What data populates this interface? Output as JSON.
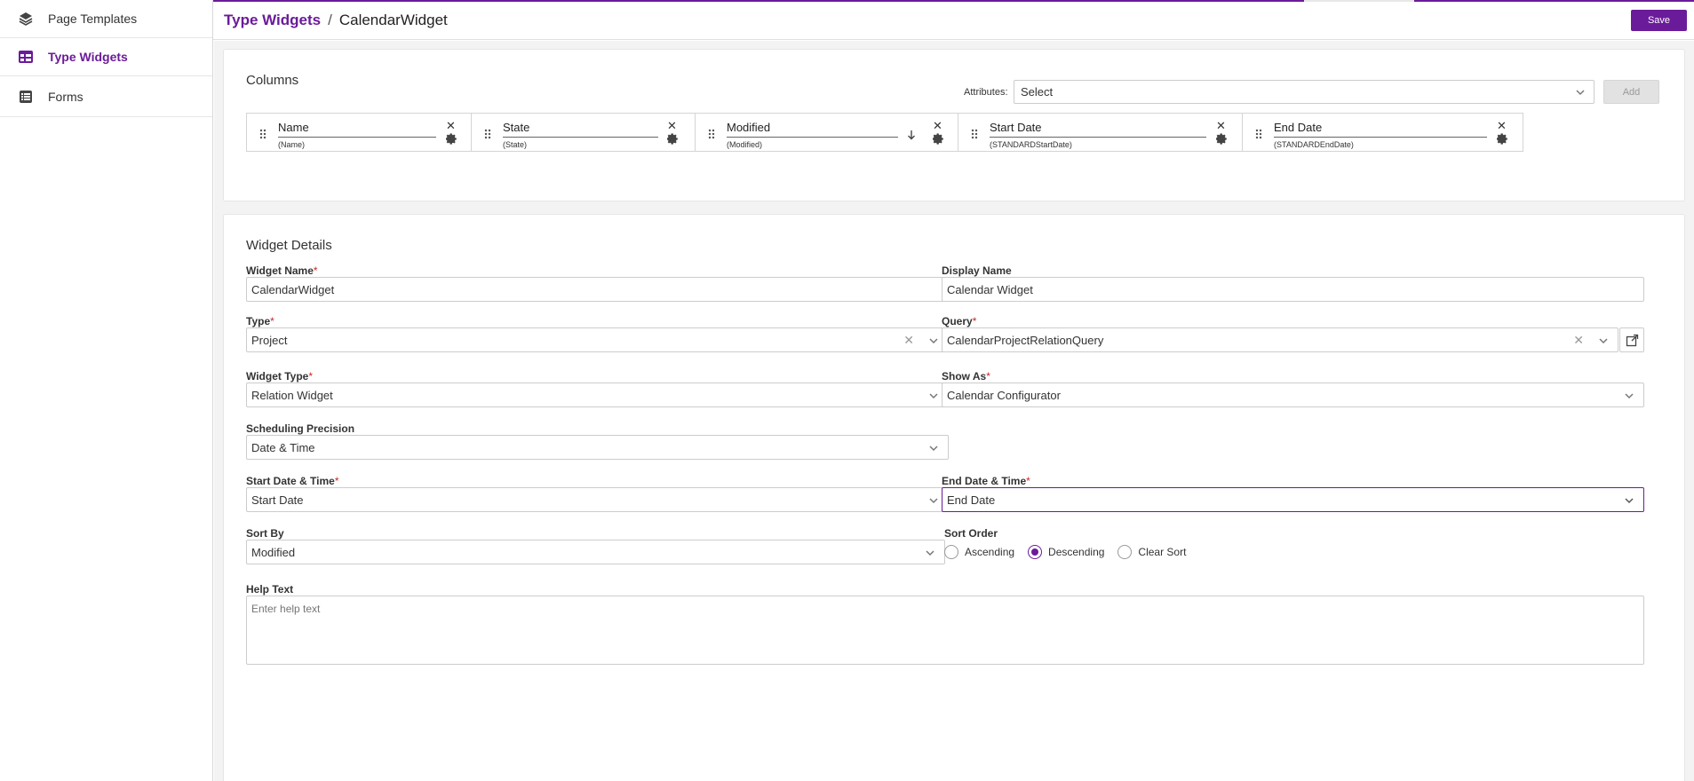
{
  "sidebar": {
    "items": [
      {
        "label": "Page Templates",
        "icon": "layers-icon",
        "active": false
      },
      {
        "label": "Type Widgets",
        "icon": "table-icon",
        "active": true
      },
      {
        "label": "Forms",
        "icon": "list-icon",
        "active": false
      }
    ]
  },
  "header": {
    "breadcrumb_parent": "Type Widgets",
    "separator": "/",
    "breadcrumb_current": "CalendarWidget",
    "save_label": "Save"
  },
  "columns_card": {
    "title": "Columns",
    "attributes_label": "Attributes:",
    "attributes_value": "Select",
    "add_label": "Add",
    "columns": [
      {
        "name": "Name",
        "field": "(Name)"
      },
      {
        "name": "State",
        "field": "(State)"
      },
      {
        "name": "Modified",
        "field": "(Modified)",
        "sort": "descending"
      },
      {
        "name": "Start Date",
        "field": "(STANDARDStartDate)"
      },
      {
        "name": "End Date",
        "field": "(STANDARDEndDate)"
      }
    ]
  },
  "details": {
    "title": "Widget Details",
    "required_mark": "*",
    "widget_name": {
      "label": "Widget Name",
      "value": "CalendarWidget"
    },
    "display_name": {
      "label": "Display Name",
      "value": "Calendar Widget"
    },
    "type": {
      "label": "Type",
      "value": "Project"
    },
    "query": {
      "label": "Query",
      "value": "CalendarProjectRelationQuery"
    },
    "widget_type": {
      "label": "Widget Type",
      "value": "Relation Widget"
    },
    "show_as": {
      "label": "Show As",
      "value": "Calendar Configurator"
    },
    "scheduling_precision": {
      "label": "Scheduling Precision",
      "value": "Date & Time"
    },
    "start_date_time": {
      "label": "Start Date & Time",
      "value": "Start Date"
    },
    "end_date_time": {
      "label": "End Date & Time",
      "value": "End Date"
    },
    "sort_by": {
      "label": "Sort By",
      "value": "Modified"
    },
    "sort_order": {
      "label": "Sort Order",
      "options": [
        "Ascending",
        "Descending",
        "Clear Sort"
      ],
      "selected": "Descending"
    },
    "help_text": {
      "label": "Help Text",
      "placeholder": "Enter help text"
    }
  },
  "colors": {
    "accent": "#6a1b9a",
    "required": "#c62828"
  }
}
